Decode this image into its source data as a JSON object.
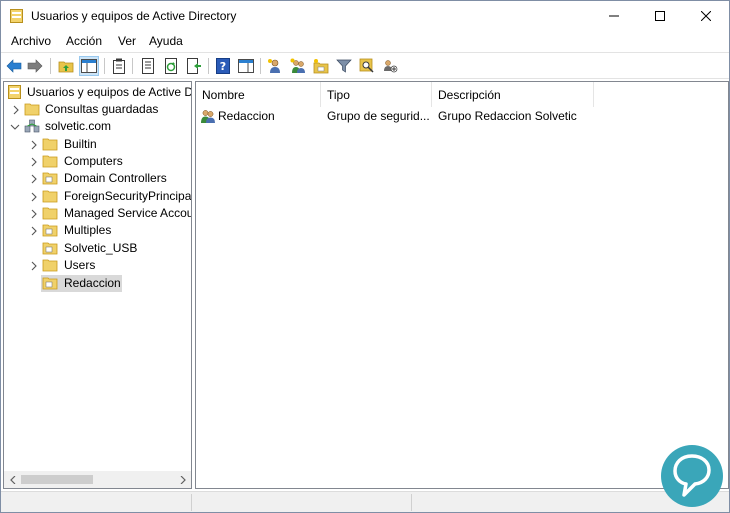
{
  "window": {
    "title": "Usuarios y equipos de Active Directory"
  },
  "menu": {
    "items": [
      "Archivo",
      "Acción",
      "Ver",
      "Ayuda"
    ]
  },
  "tree": {
    "root_label": "Usuarios y equipos de Active Directory",
    "saved_queries": "Consultas guardadas",
    "domain": "solvetic.com",
    "children": [
      {
        "label": "Builtin",
        "expandable": true,
        "ou": false
      },
      {
        "label": "Computers",
        "expandable": true,
        "ou": false
      },
      {
        "label": "Domain Controllers",
        "expandable": true,
        "ou": true
      },
      {
        "label": "ForeignSecurityPrincipals",
        "expandable": true,
        "ou": false
      },
      {
        "label": "Managed Service Accounts",
        "expandable": true,
        "ou": false
      },
      {
        "label": "Multiples",
        "expandable": true,
        "ou": true
      },
      {
        "label": "Solvetic_USB",
        "expandable": false,
        "ou": true
      },
      {
        "label": "Users",
        "expandable": true,
        "ou": false
      },
      {
        "label": "Redaccion",
        "expandable": false,
        "ou": true,
        "selected": true
      }
    ]
  },
  "list": {
    "columns": [
      "Nombre",
      "Tipo",
      "Descripción"
    ],
    "rows": [
      {
        "name": "Redaccion",
        "type": "Grupo de segurid...",
        "description": "Grupo Redaccion Solvetic"
      }
    ]
  },
  "colors": {
    "folder": "#e8c44a",
    "folder_dark": "#c99a1a",
    "selection": "#d9d9d9",
    "accent_blue": "#1e73be",
    "logo_teal": "#3aa6b9"
  }
}
